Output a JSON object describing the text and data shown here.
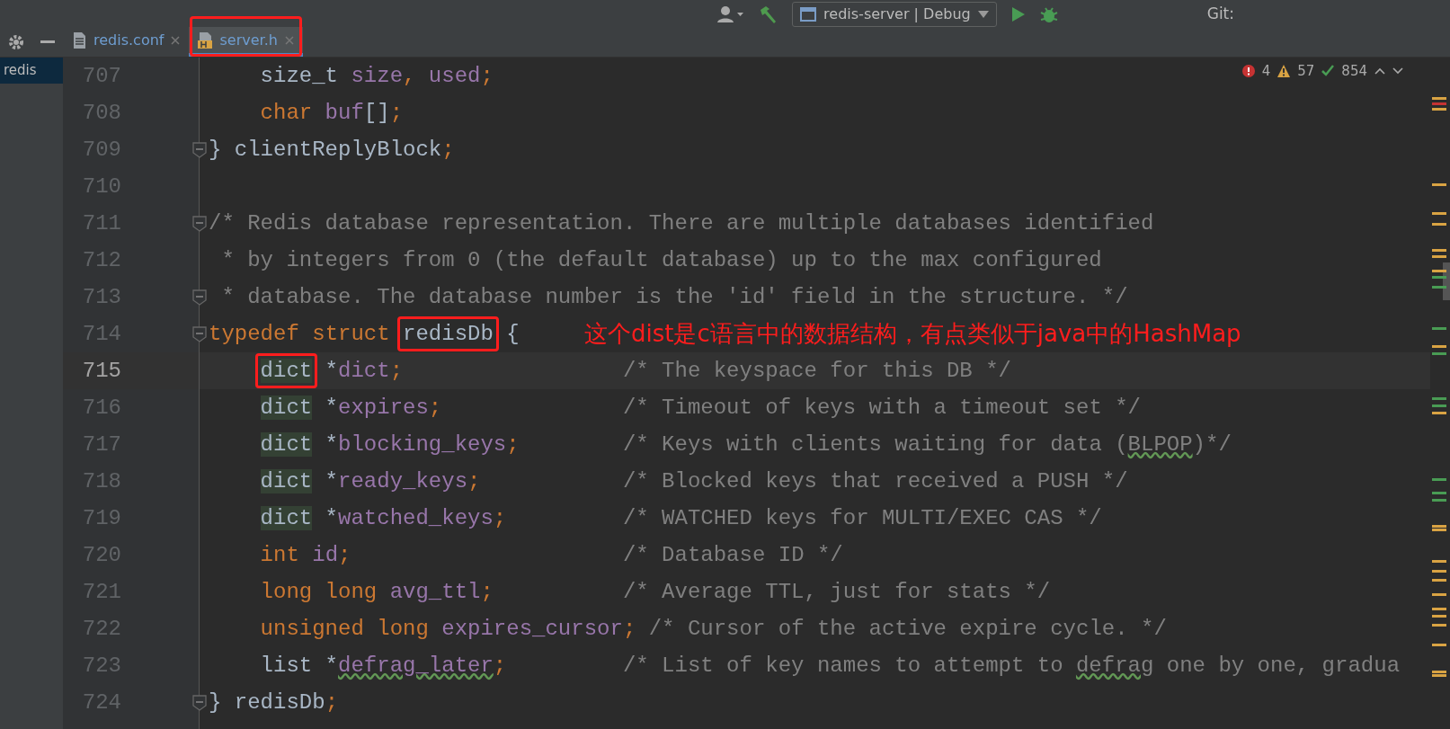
{
  "toolbar": {
    "run_config": "redis-server | Debug",
    "vcs_label": "Git:"
  },
  "tabs": [
    {
      "label": "redis.conf",
      "kind": "text",
      "selected": false,
      "annotated": false
    },
    {
      "label": "server.h",
      "kind": "header",
      "selected": true,
      "annotated": true
    }
  ],
  "sidebar": {
    "items": [
      {
        "label": "redis",
        "selected": true
      }
    ]
  },
  "inspections": {
    "errors": "4",
    "warnings": "57",
    "typos": "854"
  },
  "editor": {
    "lines": [
      {
        "number": "707",
        "current": false,
        "fold": false,
        "indented": true,
        "tokens": [
          {
            "text": "size_t",
            "kind": "plain"
          },
          {
            "text": " size",
            "kind": "field"
          },
          {
            "text": ",",
            "kind": "punct"
          },
          {
            "text": " used",
            "kind": "field"
          },
          {
            "text": ";",
            "kind": "punct"
          }
        ]
      },
      {
        "number": "708",
        "current": false,
        "fold": false,
        "indented": true,
        "tokens": [
          {
            "text": "char",
            "kind": "keyword"
          },
          {
            "text": " buf",
            "kind": "field"
          },
          {
            "text": "[]",
            "kind": "plain"
          },
          {
            "text": ";",
            "kind": "punct"
          }
        ]
      },
      {
        "number": "709",
        "current": false,
        "fold": true,
        "indented": false,
        "tokens": [
          {
            "text": "} clientReplyBlock",
            "kind": "plain"
          },
          {
            "text": ";",
            "kind": "punct"
          }
        ]
      },
      {
        "number": "710",
        "current": false,
        "fold": false
      },
      {
        "number": "711",
        "current": false,
        "fold": true,
        "indented": false,
        "tokens": [
          {
            "text": "/* Redis database representation. There are multiple databases identified",
            "kind": "comment"
          }
        ]
      },
      {
        "number": "712",
        "current": false,
        "fold": false,
        "indented": false,
        "tokens": [
          {
            "text": " * by integers from 0 (the default database) up to the max configured",
            "kind": "comment"
          }
        ]
      },
      {
        "number": "713",
        "current": false,
        "fold": true,
        "indented": false,
        "tokens": [
          {
            "text": " * database. The database number is the 'id' field in the structure. */",
            "kind": "comment"
          }
        ]
      },
      {
        "number": "714",
        "current": false,
        "fold": true,
        "indented": false,
        "tokens": [
          {
            "text": "typedef",
            "kind": "keyword"
          },
          {
            "text": " struct ",
            "kind": "keyword"
          },
          {
            "text": "redisDb",
            "kind": "plain",
            "boxed": true
          },
          {
            "text": " {",
            "kind": "plain"
          }
        ]
      },
      {
        "number": "715",
        "current": true,
        "fold": false,
        "indented": true,
        "tokens": [
          {
            "text": "dict",
            "kind": "usage",
            "boxed": true
          },
          {
            "text": " *",
            "kind": "plain"
          },
          {
            "text": "dict",
            "kind": "field"
          },
          {
            "text": ";",
            "kind": "punct"
          },
          {
            "text": "                 /* The keyspace for this DB */",
            "kind": "comment"
          }
        ]
      },
      {
        "number": "716",
        "current": false,
        "fold": false,
        "indented": true,
        "tokens": [
          {
            "text": "dict",
            "kind": "usage"
          },
          {
            "text": " *",
            "kind": "plain"
          },
          {
            "text": "expires",
            "kind": "field"
          },
          {
            "text": ";",
            "kind": "punct"
          },
          {
            "text": "              /* Timeout of keys with a timeout set */",
            "kind": "comment"
          }
        ]
      },
      {
        "number": "717",
        "current": false,
        "fold": false,
        "indented": true,
        "tokens": [
          {
            "text": "dict",
            "kind": "usage"
          },
          {
            "text": " *",
            "kind": "plain"
          },
          {
            "text": "blocking_keys",
            "kind": "field"
          },
          {
            "text": ";",
            "kind": "punct"
          },
          {
            "text": "        /* Keys with clients waiting for data (",
            "kind": "comment"
          },
          {
            "text": "BLPOP",
            "kind": "comment_typo"
          },
          {
            "text": ")*/",
            "kind": "comment"
          }
        ]
      },
      {
        "number": "718",
        "current": false,
        "fold": false,
        "indented": true,
        "tokens": [
          {
            "text": "dict",
            "kind": "usage"
          },
          {
            "text": " *",
            "kind": "plain"
          },
          {
            "text": "ready_keys",
            "kind": "field"
          },
          {
            "text": ";",
            "kind": "punct"
          },
          {
            "text": "           /* Blocked keys that received a PUSH */",
            "kind": "comment"
          }
        ]
      },
      {
        "number": "719",
        "current": false,
        "fold": false,
        "indented": true,
        "tokens": [
          {
            "text": "dict",
            "kind": "usage"
          },
          {
            "text": " *",
            "kind": "plain"
          },
          {
            "text": "watched_keys",
            "kind": "field"
          },
          {
            "text": ";",
            "kind": "punct"
          },
          {
            "text": "         /* WATCHED keys for MULTI/EXEC CAS */",
            "kind": "comment"
          }
        ]
      },
      {
        "number": "720",
        "current": false,
        "fold": false,
        "indented": true,
        "tokens": [
          {
            "text": "int",
            "kind": "keyword"
          },
          {
            "text": " id",
            "kind": "field"
          },
          {
            "text": ";",
            "kind": "punct"
          },
          {
            "text": "                     /* Database ID */",
            "kind": "comment"
          }
        ]
      },
      {
        "number": "721",
        "current": false,
        "fold": false,
        "indented": true,
        "tokens": [
          {
            "text": "long long",
            "kind": "keyword"
          },
          {
            "text": " avg_ttl",
            "kind": "field"
          },
          {
            "text": ";",
            "kind": "punct"
          },
          {
            "text": "          /* Average TTL, just for stats */",
            "kind": "comment"
          }
        ]
      },
      {
        "number": "722",
        "current": false,
        "fold": false,
        "indented": true,
        "tokens": [
          {
            "text": "unsigned long",
            "kind": "keyword"
          },
          {
            "text": " expires_cursor",
            "kind": "field"
          },
          {
            "text": ";",
            "kind": "punct"
          },
          {
            "text": " /* Cursor of the active expire cycle. */",
            "kind": "comment"
          }
        ]
      },
      {
        "number": "723",
        "current": false,
        "fold": false,
        "indented": true,
        "tokens": [
          {
            "text": "list *",
            "kind": "plain"
          },
          {
            "text": "defrag_later",
            "kind": "field_typo"
          },
          {
            "text": ";",
            "kind": "punct"
          },
          {
            "text": "         /* List of key names to attempt to ",
            "kind": "comment"
          },
          {
            "text": "defrag",
            "kind": "comment_typo"
          },
          {
            "text": " one by one, gradua",
            "kind": "comment"
          }
        ]
      },
      {
        "number": "724",
        "current": false,
        "fold": true,
        "indented": false,
        "tokens": [
          {
            "text": "} redisDb",
            "kind": "plain"
          },
          {
            "text": ";",
            "kind": "punct"
          }
        ]
      }
    ]
  },
  "annotation": {
    "text": "这个dist是c语言中的数据结构，有点类似于java中的HashMap"
  }
}
